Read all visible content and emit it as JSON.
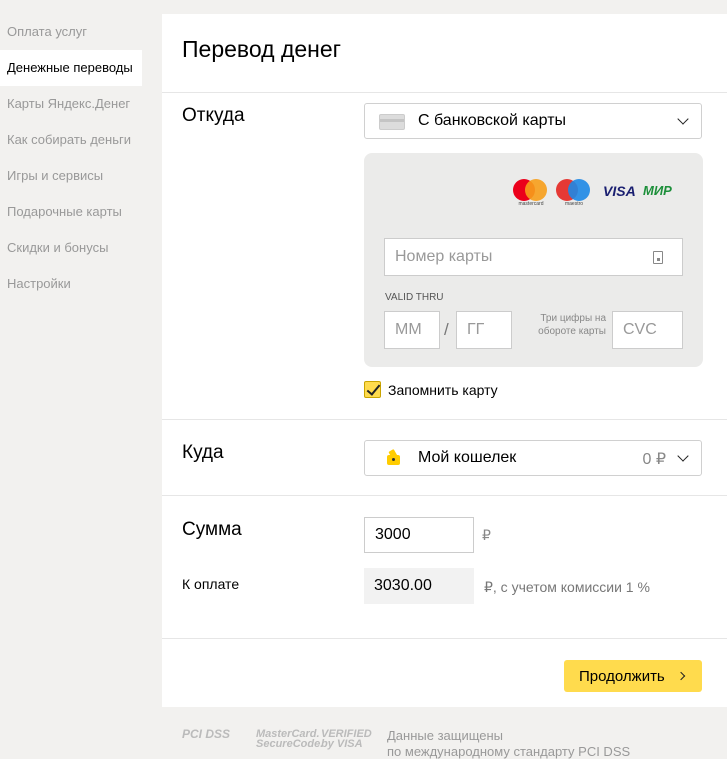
{
  "sidebar": {
    "items": [
      {
        "label": "Оплата услуг"
      },
      {
        "label": "Денежные переводы"
      },
      {
        "label": "Карты Яндекс.Денег"
      },
      {
        "label": "Как собирать деньги"
      },
      {
        "label": "Игры и сервисы"
      },
      {
        "label": "Подарочные карты"
      },
      {
        "label": "Скидки и бонусы"
      },
      {
        "label": "Настройки"
      }
    ],
    "active_index": 1
  },
  "main": {
    "title": "Перевод денег",
    "from": {
      "label": "Откуда",
      "selected": "С банковской карты",
      "card_logos": {
        "mastercard": "mastercard",
        "maestro": "maestro",
        "visa": "VISA",
        "mir": "МИР"
      },
      "card_number_placeholder": "Номер карты",
      "valid_thru_label": "VALID THRU",
      "month_placeholder": "ММ",
      "slash": "/",
      "year_placeholder": "ГГ",
      "cvc_hint": "Три цифры на обороте карты",
      "cvc_placeholder": "CVC",
      "remember_label": "Запомнить карту",
      "remember_checked": true
    },
    "to": {
      "label": "Куда",
      "selected": "Мой кошелек",
      "balance": "0 ₽"
    },
    "sum": {
      "label": "Сумма",
      "amount_value": "3000",
      "currency": "₽",
      "pay_label": "К оплате",
      "pay_value": "3030.00",
      "pay_note": "₽, с учетом комиссии 1 %"
    },
    "continue_label": "Продолжить"
  },
  "footer": {
    "logos": [
      "PCI DSS",
      "MasterCard. SecureCode.",
      "VERIFIED by VISA"
    ],
    "text_line1": "Данные защищены",
    "text_line2": "по международному стандарту PCI DSS"
  },
  "colors": {
    "accent_yellow": "#ffdb4d",
    "page_bg": "#f2f1ef",
    "card_bg": "#ebebea"
  }
}
